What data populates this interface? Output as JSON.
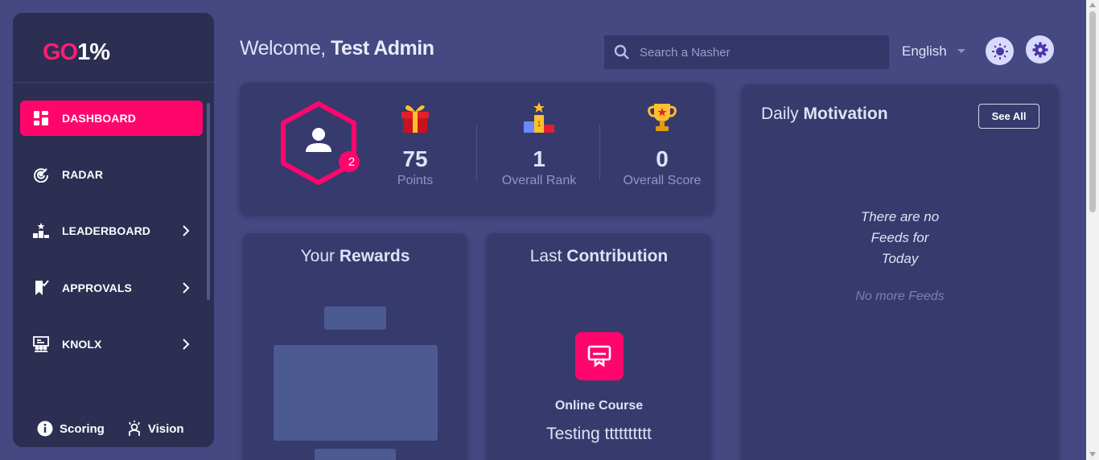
{
  "logo": {
    "part1": "GO",
    "part2": "1%"
  },
  "sidebar": {
    "items": [
      {
        "label": "DASHBOARD",
        "icon": "dashboard-icon",
        "active": true
      },
      {
        "label": "RADAR",
        "icon": "radar-icon"
      },
      {
        "label": "LEADERBOARD",
        "icon": "leaderboard-icon"
      },
      {
        "label": "APPROVALS",
        "icon": "approvals-icon"
      },
      {
        "label": "KNOLX",
        "icon": "knolx-icon"
      }
    ],
    "footer": {
      "scoring": "Scoring",
      "vision": "Vision"
    }
  },
  "header": {
    "welcome_prefix": "Welcome,",
    "user_name": "Test Admin",
    "search_placeholder": "Search a Nasher",
    "language": "English"
  },
  "stats": {
    "badge": "2",
    "points_value": "75",
    "points_label": "Points",
    "rank_value": "1",
    "rank_label": "Overall Rank",
    "score_value": "0",
    "score_label": "Overall Score"
  },
  "rewards": {
    "title_prefix": "Your",
    "title_bold": "Rewards"
  },
  "contribution": {
    "title_prefix": "Last",
    "title_bold": "Contribution",
    "type": "Online Course",
    "name": "Testing tttttttttt"
  },
  "motivation": {
    "title_prefix": "Daily",
    "title_bold": "Motivation",
    "see_all": "See All",
    "empty_line1": "There are no",
    "empty_line2": "Feeds for",
    "empty_line3": "Today",
    "no_more": "No more Feeds"
  },
  "colors": {
    "accent": "#ff066d",
    "background": "#454881",
    "card": "#373a6c",
    "sidebar": "#2c2e52"
  }
}
